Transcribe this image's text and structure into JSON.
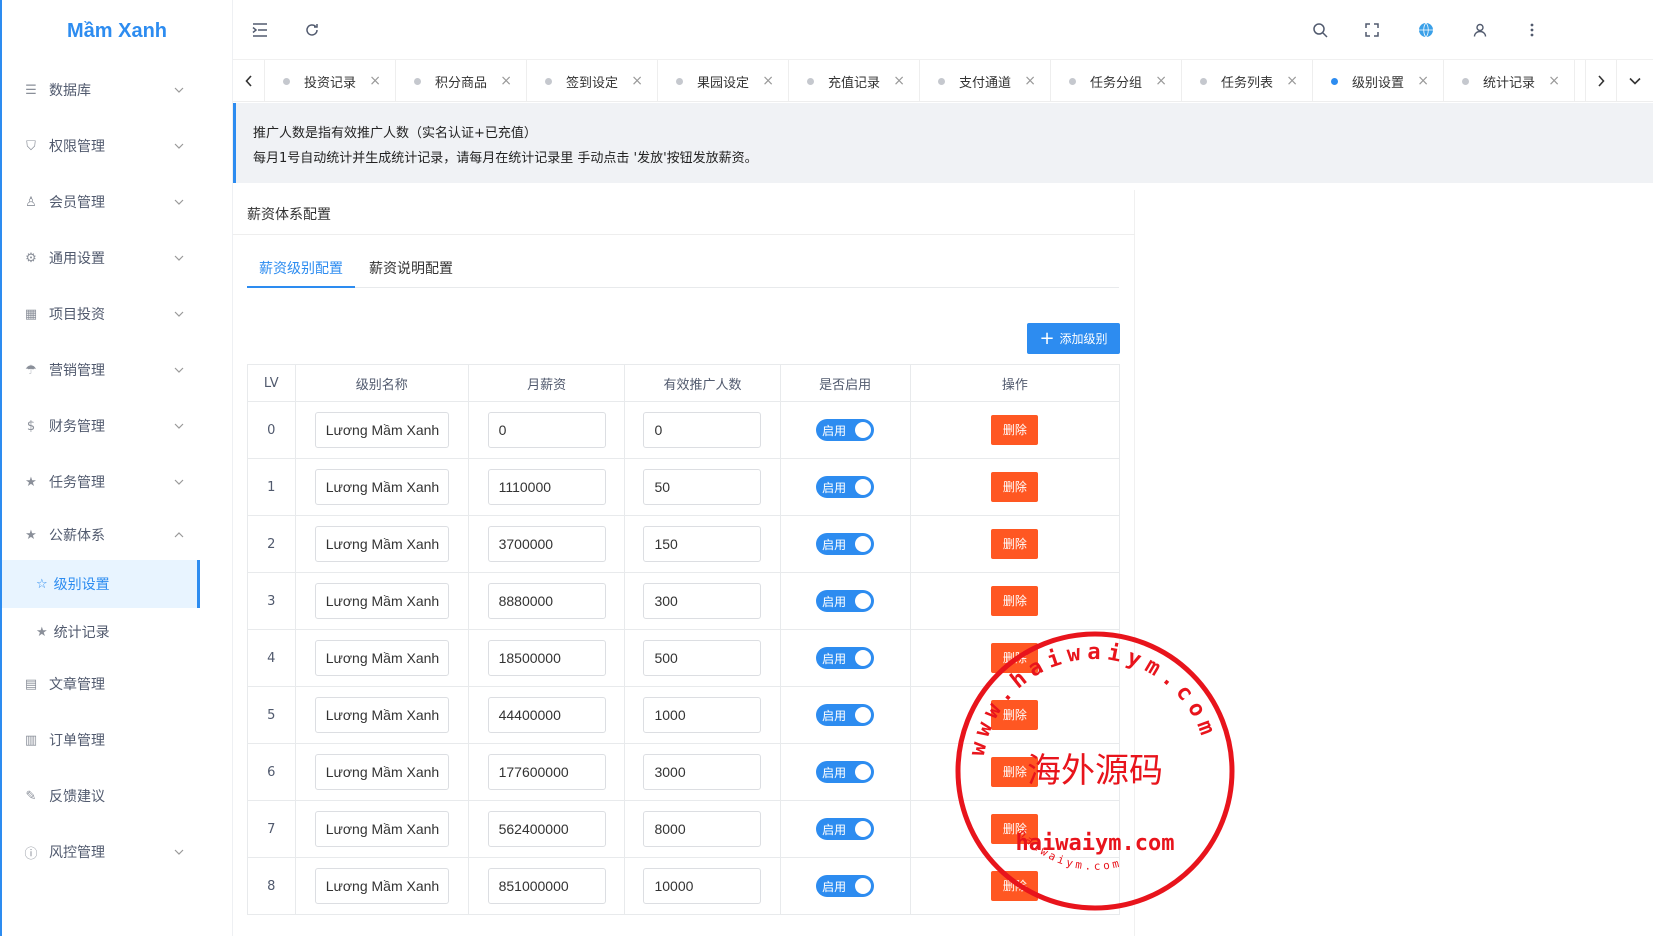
{
  "app": {
    "logo": "Mầm Xanh"
  },
  "sidebar": {
    "items": [
      {
        "icon": "database-icon",
        "glyph": "☰",
        "label": "数据库"
      },
      {
        "icon": "shield-icon",
        "glyph": "⛉",
        "label": "权限管理"
      },
      {
        "icon": "user-icon",
        "glyph": "♙",
        "label": "会员管理"
      },
      {
        "icon": "gear-icon",
        "glyph": "⚙",
        "label": "通用设置"
      },
      {
        "icon": "grid-icon",
        "glyph": "▦",
        "label": "项目投资"
      },
      {
        "icon": "umbrella-icon",
        "glyph": "☂",
        "label": "营销管理"
      },
      {
        "icon": "dollar-icon",
        "glyph": "$",
        "label": "财务管理"
      },
      {
        "icon": "star-icon",
        "glyph": "★",
        "label": "任务管理"
      },
      {
        "icon": "star-icon",
        "glyph": "★",
        "label": "公薪体系"
      },
      {
        "icon": "book-icon",
        "glyph": "▤",
        "label": "文章管理"
      },
      {
        "icon": "order-icon",
        "glyph": "▥",
        "label": "订单管理"
      },
      {
        "icon": "feedback-icon",
        "glyph": "✎",
        "label": "反馈建议"
      },
      {
        "icon": "info-icon",
        "glyph": "ⓘ",
        "label": "风控管理"
      }
    ],
    "sub": [
      {
        "glyph": "☆",
        "label": "级别设置"
      },
      {
        "glyph": "★",
        "label": "统计记录"
      }
    ]
  },
  "tabs": [
    "投资记录",
    "积分商品",
    "签到设定",
    "果园设定",
    "充值记录",
    "支付通道",
    "任务分组",
    "任务列表",
    "级别设置",
    "统计记录"
  ],
  "active_tab": "级别设置",
  "notice": {
    "line1": "推广人数是指有效推广人数（实名认证+已充值）",
    "line2": "每月1号自动统计并生成统计记录，请每月在统计记录里 手动点击 '发放'按钮发放薪资。"
  },
  "card": {
    "title": "薪资体系配置",
    "tabs": [
      "薪资级别配置",
      "薪资说明配置"
    ],
    "add_label": "添加级别"
  },
  "table": {
    "headers": [
      "LV",
      "级别名称",
      "月薪资",
      "有效推广人数",
      "是否启用",
      "操作"
    ],
    "switch_label": "启用",
    "delete_label": "删除",
    "rows": [
      {
        "lv": "0",
        "name": "Lương Mầm Xanh",
        "salary": "0",
        "count": "0"
      },
      {
        "lv": "1",
        "name": "Lương Mầm Xanh",
        "salary": "1110000",
        "count": "50"
      },
      {
        "lv": "2",
        "name": "Lương Mầm Xanh",
        "salary": "3700000",
        "count": "150"
      },
      {
        "lv": "3",
        "name": "Lương Mầm Xanh",
        "salary": "8880000",
        "count": "300"
      },
      {
        "lv": "4",
        "name": "Lương Mầm Xanh",
        "salary": "18500000",
        "count": "500"
      },
      {
        "lv": "5",
        "name": "Lương Mầm Xanh",
        "salary": "44400000",
        "count": "1000"
      },
      {
        "lv": "6",
        "name": "Lương Mầm Xanh",
        "salary": "177600000",
        "count": "3000"
      },
      {
        "lv": "7",
        "name": "Lương Mầm Xanh",
        "salary": "562400000",
        "count": "8000"
      },
      {
        "lv": "8",
        "name": "Lương Mầm Xanh",
        "salary": "851000000",
        "count": "10000"
      }
    ]
  },
  "watermark": {
    "ring_text": "www.haiwaiym.com",
    "center_text": "海外源码",
    "bottom_text": "haiwaiym.com",
    "small_text": "haiwaiym.com",
    "color": "#e8141c"
  }
}
